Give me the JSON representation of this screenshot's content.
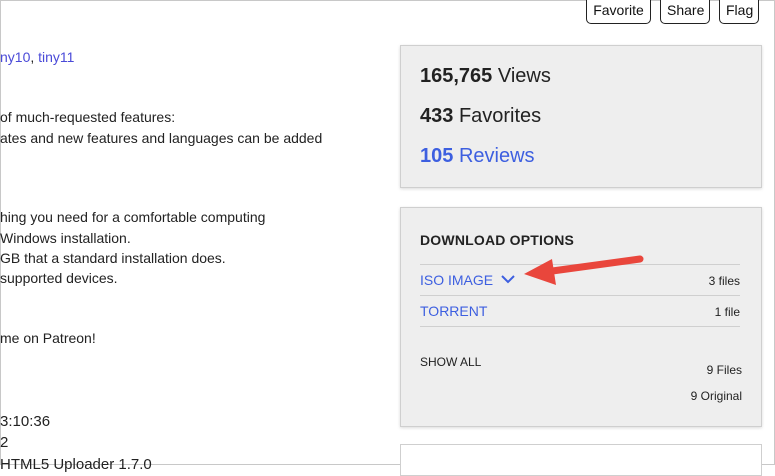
{
  "toolbar": {
    "favorite_label": "Favorite",
    "share_label": "Share",
    "flag_label": "Flag"
  },
  "left": {
    "links": [
      "ny10",
      "tiny11"
    ],
    "link_sep": ", ",
    "lines": [
      "of much-requested features:",
      "ates and new features and languages can be added",
      "hing you need for a comfortable computing",
      "Windows installation.",
      "GB that a standard installation does.",
      "supported devices.",
      "me on Patreon!",
      "3:10:36",
      "2",
      "HTML5 Uploader 1.7.0"
    ]
  },
  "stats": {
    "views_num": "165,765",
    "views_label": "Views",
    "favorites_num": "433",
    "favorites_label": "Favorites",
    "reviews_num": "105",
    "reviews_label": "Reviews"
  },
  "download": {
    "title": "DOWNLOAD OPTIONS",
    "rows": [
      {
        "name": "ISO IMAGE",
        "count": "3 files"
      },
      {
        "name": "TORRENT",
        "count": "1 file"
      }
    ],
    "show_all": "SHOW ALL",
    "total_files": "9 Files",
    "original": "9 Original"
  },
  "colors": {
    "link": "#4a4ad8",
    "panel_bg": "#eeeeee",
    "arrow": "#e9463c"
  }
}
